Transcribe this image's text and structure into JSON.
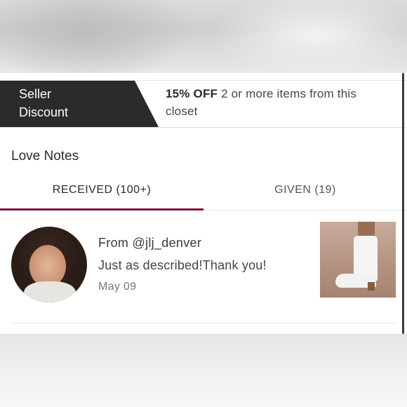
{
  "discount": {
    "tag_line1": "Seller",
    "tag_line2": "Discount",
    "offer_bold": "15% OFF",
    "offer_rest": " 2 or more items from this closet"
  },
  "love_notes": {
    "title": "Love Notes",
    "tabs": [
      {
        "label": "RECEIVED (100+)",
        "active": true
      },
      {
        "label": "GIVEN (19)",
        "active": false
      }
    ],
    "notes": [
      {
        "from": "From @jlj_denver",
        "message": "Just as described!Thank you!",
        "date": "May 09"
      }
    ]
  },
  "colors": {
    "tag_bg": "#2b2b2b",
    "active_tab_underline": "#7b1745"
  }
}
